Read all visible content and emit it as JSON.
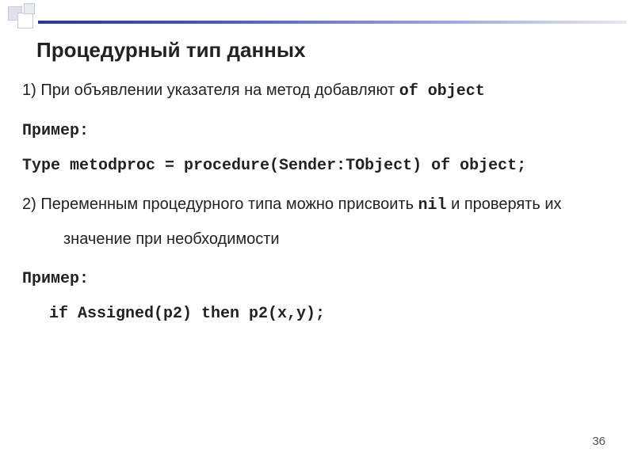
{
  "slide": {
    "title": "Процедурный тип данных",
    "point1_prefix": "1) При объявлении указателя на метод добавляют ",
    "point1_code": "of object",
    "example_label": "Пример:",
    "code1": "Type metodproc = procedure(Sender:TObject) of object;",
    "point2_prefix": "2) Переменным процедурного типа можно присвоить ",
    "point2_code": "nil",
    "point2_suffix": " и проверять их",
    "point2_line2": "значение при необходимости",
    "code2": "if Assigned(p2) then p2(x,y);",
    "page_number": "36"
  }
}
